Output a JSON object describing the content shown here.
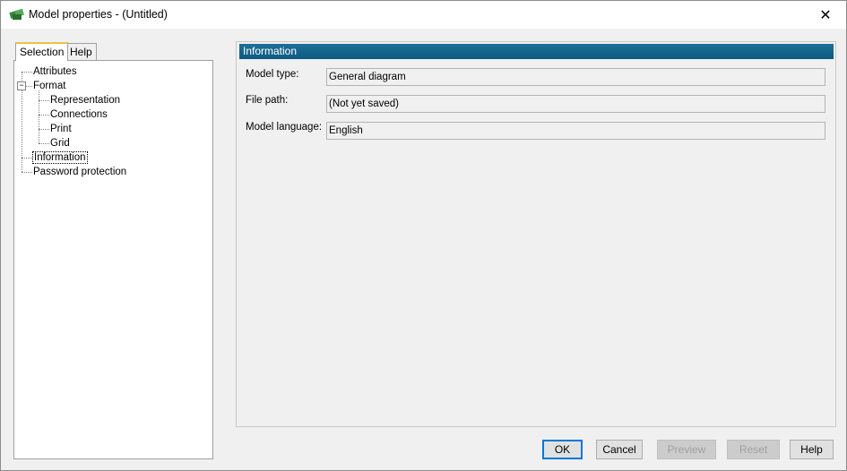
{
  "window": {
    "title": "Model properties - (Untitled)",
    "close_glyph": "✕"
  },
  "tabs": [
    {
      "label": "Selection"
    },
    {
      "label": "Help"
    }
  ],
  "tree": {
    "items": [
      {
        "label": "Attributes"
      },
      {
        "label": "Format",
        "expander": "−"
      },
      {
        "label": "Representation"
      },
      {
        "label": "Connections"
      },
      {
        "label": "Print"
      },
      {
        "label": "Grid"
      },
      {
        "label": "Information"
      },
      {
        "label": "Password protection"
      }
    ]
  },
  "info": {
    "header": "Information",
    "fields": [
      {
        "label": "Model type:",
        "value": "General diagram"
      },
      {
        "label": "File path:",
        "value": "(Not yet saved)"
      },
      {
        "label": "Model language:",
        "value": "English"
      }
    ]
  },
  "buttons": {
    "ok": "OK",
    "cancel": "Cancel",
    "preview": "Preview",
    "reset": "Reset",
    "help": "Help"
  }
}
